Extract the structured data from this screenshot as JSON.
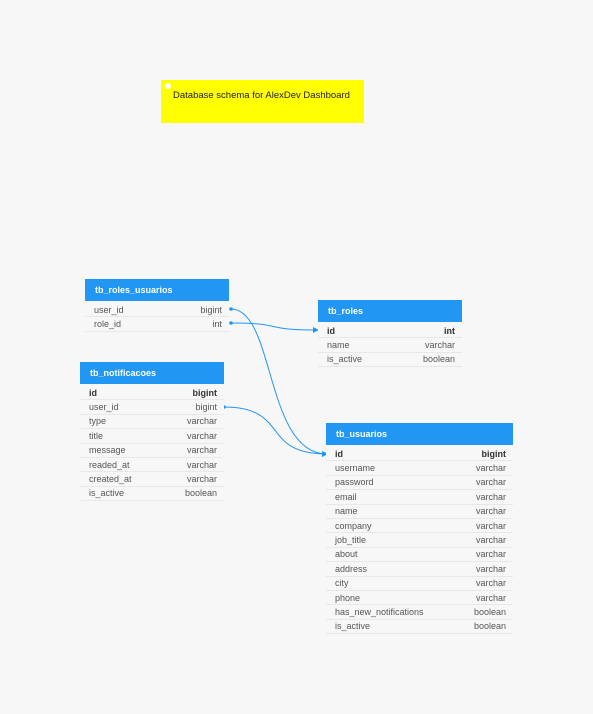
{
  "note": {
    "text": "Database schema for AlexDev Dashboard"
  },
  "tables": {
    "roles_usuarios": {
      "name": "tb_roles_usuarios",
      "columns": [
        {
          "name": "user_id",
          "type": "bigint"
        },
        {
          "name": "role_id",
          "type": "int"
        }
      ]
    },
    "roles": {
      "name": "tb_roles",
      "columns": [
        {
          "name": "id",
          "type": "int"
        },
        {
          "name": "name",
          "type": "varchar"
        },
        {
          "name": "is_active",
          "type": "boolean"
        }
      ]
    },
    "notificacoes": {
      "name": "tb_notificacoes",
      "columns": [
        {
          "name": "id",
          "type": "bigint"
        },
        {
          "name": "user_id",
          "type": "bigint"
        },
        {
          "name": "type",
          "type": "varchar"
        },
        {
          "name": "title",
          "type": "varchar"
        },
        {
          "name": "message",
          "type": "varchar"
        },
        {
          "name": "readed_at",
          "type": "varchar"
        },
        {
          "name": "created_at",
          "type": "varchar"
        },
        {
          "name": "is_active",
          "type": "boolean"
        }
      ]
    },
    "usuarios": {
      "name": "tb_usuarios",
      "columns": [
        {
          "name": "id",
          "type": "bigint"
        },
        {
          "name": "username",
          "type": "varchar"
        },
        {
          "name": "password",
          "type": "varchar"
        },
        {
          "name": "email",
          "type": "varchar"
        },
        {
          "name": "name",
          "type": "varchar"
        },
        {
          "name": "company",
          "type": "varchar"
        },
        {
          "name": "job_title",
          "type": "varchar"
        },
        {
          "name": "about",
          "type": "varchar"
        },
        {
          "name": "address",
          "type": "varchar"
        },
        {
          "name": "city",
          "type": "varchar"
        },
        {
          "name": "phone",
          "type": "varchar"
        },
        {
          "name": "has_new_notifications",
          "type": "boolean"
        },
        {
          "name": "is_active",
          "type": "boolean"
        }
      ]
    }
  },
  "colors": {
    "header": "#2196f3",
    "link": "#2196f3",
    "note": "#ffff00"
  }
}
